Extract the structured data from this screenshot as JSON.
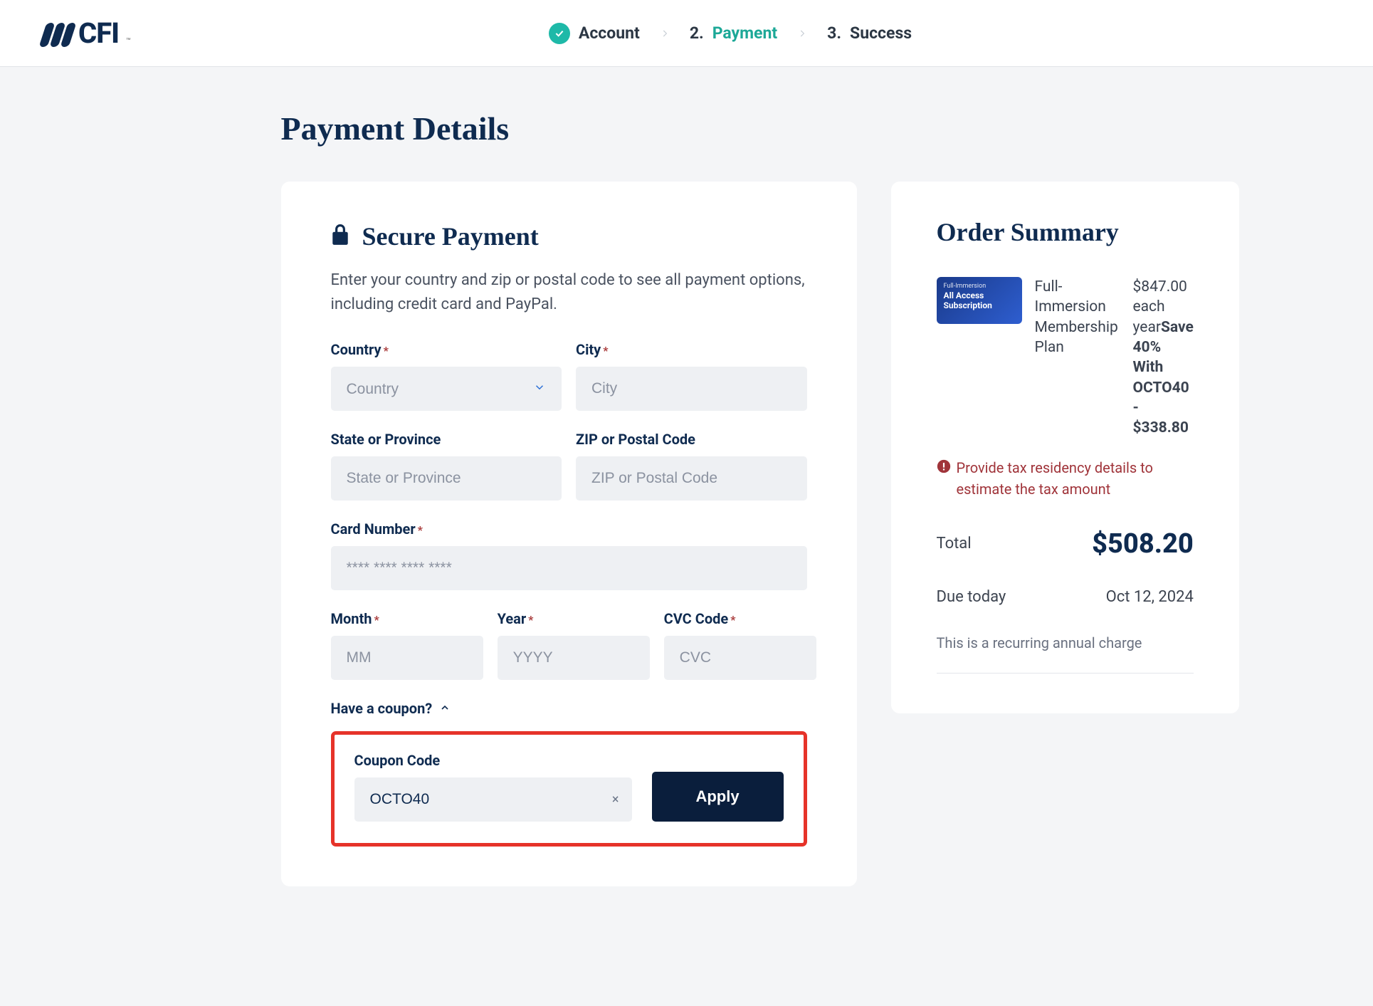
{
  "brand": {
    "name": "CFI",
    "tm": "™"
  },
  "stepper": {
    "account": "Account",
    "payment_num": "2.",
    "payment": "Payment",
    "success_num": "3.",
    "success": "Success"
  },
  "page": {
    "title": "Payment Details"
  },
  "payment": {
    "heading": "Secure Payment",
    "desc": "Enter your country and zip or postal code to see all payment options, including credit card and PayPal.",
    "labels": {
      "country": "Country",
      "city": "City",
      "state": "State or Province",
      "zip": "ZIP or Postal Code",
      "card": "Card Number",
      "month": "Month",
      "year": "Year",
      "cvc": "CVC Code",
      "coupon_toggle": "Have a coupon?",
      "coupon": "Coupon Code"
    },
    "placeholders": {
      "country": "Country",
      "city": "City",
      "state": "State or Province",
      "zip": "ZIP or Postal Code",
      "card": "**** **** **** ****",
      "month": "MM",
      "year": "YYYY",
      "cvc": "CVC"
    },
    "coupon_value": "OCTO40",
    "apply": "Apply"
  },
  "summary": {
    "heading": "Order Summary",
    "thumb_line1": "Full-Immersion",
    "thumb_line2": "All Access Subscription",
    "product_name": "Full-Immersion Membership Plan",
    "price_line1": "$847.00 each year",
    "promo_label": "Save 40% With OCTO40",
    "discount": "- $338.80",
    "tax_warning": "Provide tax residency details to estimate the tax amount",
    "total_label": "Total",
    "total_value": "$508.20",
    "due_label": "Due today",
    "due_value": "Oct 12, 2024",
    "recurring_note": "This is a recurring annual charge"
  }
}
